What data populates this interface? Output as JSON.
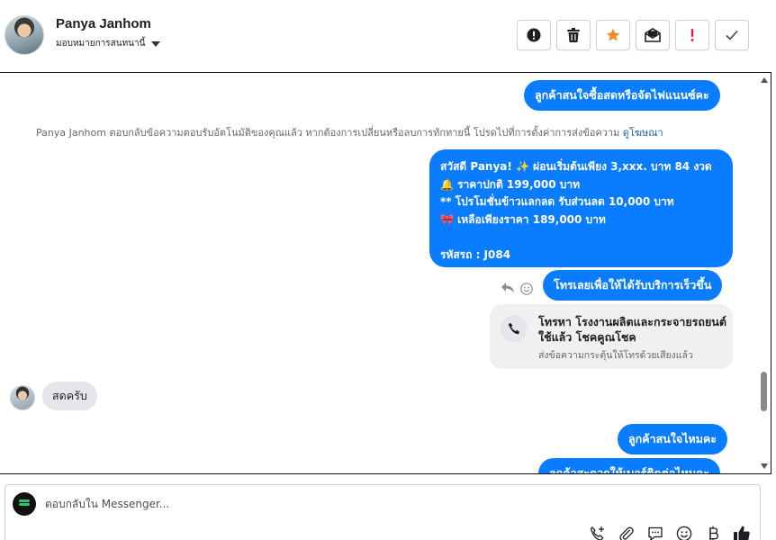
{
  "header": {
    "name": "Panya Janhom",
    "assign_label": "มอบหมายการสนทนานี้",
    "actions": [
      {
        "name": "spam-button",
        "icon": "alert-circle-icon"
      },
      {
        "name": "delete-button",
        "icon": "trash-icon"
      },
      {
        "name": "follow-up-button",
        "icon": "star-icon"
      },
      {
        "name": "mark-unread-button",
        "icon": "mail-icon"
      },
      {
        "name": "priority-button",
        "icon": "exclamation-icon"
      },
      {
        "name": "done-button",
        "icon": "check-icon"
      }
    ]
  },
  "messages": {
    "out1": "ลูกค้าสนใจซื้อสดหรือจัดไฟแนนซ์คะ",
    "notice_text": "Panya Janhom ตอบกลับข้อความตอบรับอัตโนมัติของคุณแล้ว หากต้องการเปลี่ยนหรือลบการทักทายนี้ โปรดไปที่การตั้งค่าการส่งข้อความ",
    "notice_link": "ดูโฆษณา",
    "promo_lines": [
      "สวัสดี Panya! ✨  ผ่อนเริ่มต้นเพียง 3,xxx. บาท 84 งวด",
      "🔔 ราคาปกติ 199,000 บาท",
      "** โปรโมชั่นข้าวแลกลด รับส่วนลด 10,000 บาท",
      "🎀  เหลือเพียงราคา 189,000 บาท",
      "",
      "รหัสรถ : J084"
    ],
    "out2": "โทรเลยเพื่อให้ได้รับบริการเร็วขึ้น",
    "call_title": "โทรหา โรงงานผลิตและกระจายรถยนต์ใช้แล้ว โชคคูณโชค",
    "call_sub": "ส่งข้อความกระตุ้นให้โทรด้วยเสียงแล้ว",
    "in1": "สดครับ",
    "out3": "ลูกค้าสนใจไหมคะ",
    "out4": "ลูกค้าสะดวกให้เบอร์ติดต่อไหมคะ"
  },
  "composer": {
    "placeholder": "ตอบกลับใน Messenger..."
  },
  "colors": {
    "outgoing_bubble": "#0a7cff",
    "incoming_bubble": "#e4e6eb",
    "star": "#f08a24",
    "priority": "#e41e3f"
  }
}
